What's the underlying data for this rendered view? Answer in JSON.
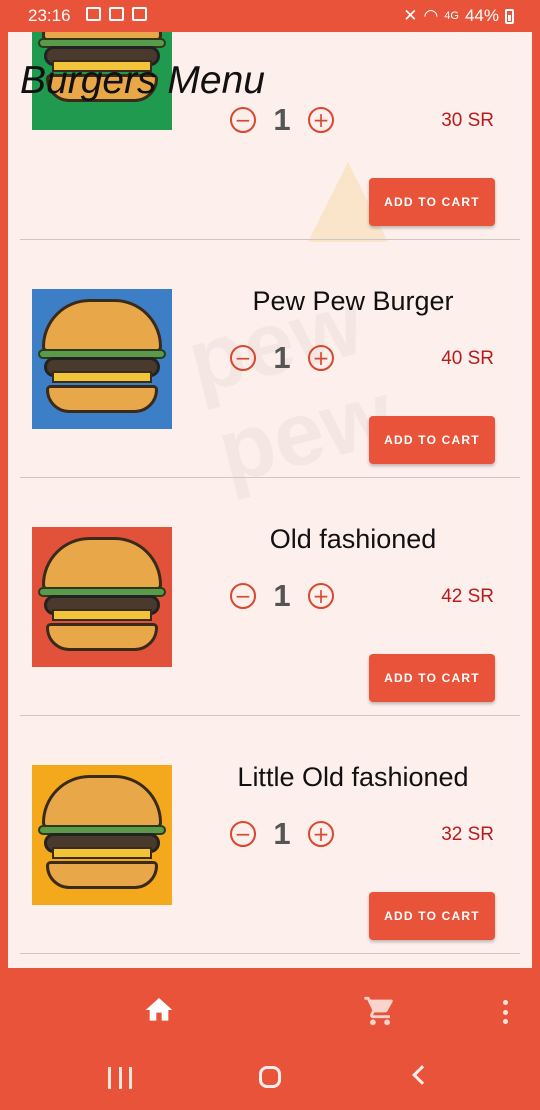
{
  "status_bar": {
    "time": "23:16",
    "battery": "44%",
    "signal_label": "4G"
  },
  "app": {
    "title": "Burgers Menu"
  },
  "common": {
    "add_to_cart_label": "ADD TO CART"
  },
  "watermark": {
    "line1": "pew",
    "line2": "pew"
  },
  "items": [
    {
      "name": "",
      "quantity": "1",
      "price": "30 SR",
      "thumb_bg": "#1f9a4f",
      "icon": "cheeseburger-image"
    },
    {
      "name": "Pew Pew Burger",
      "quantity": "1",
      "price": "40 SR",
      "thumb_bg": "#3c7fc7",
      "icon": "double-cheeseburger-image"
    },
    {
      "name": "Old fashioned",
      "quantity": "1",
      "price": "42 SR",
      "thumb_bg": "#e2523a",
      "icon": "cheeseburger-image"
    },
    {
      "name": "Little Old fashioned",
      "quantity": "1",
      "price": "32 SR",
      "thumb_bg": "#f4a81c",
      "icon": "cheeseburger-image"
    }
  ],
  "bottom_nav": {
    "home_icon": "home-icon",
    "cart_icon": "cart-icon",
    "more_icon": "more-vert-icon"
  },
  "colors": {
    "primary": "#e8533a",
    "price": "#b71c1c",
    "screen_bg": "#fdefeb"
  }
}
